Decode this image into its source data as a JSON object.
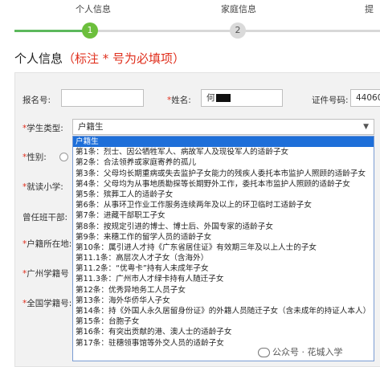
{
  "steps": [
    {
      "label": "个人信息",
      "number": "1"
    },
    {
      "label": "家庭信息",
      "number": "2"
    },
    {
      "label": "提",
      "number": ""
    }
  ],
  "section": {
    "title": "个人信息",
    "note": "（标注 * 号为必填项）"
  },
  "form": {
    "signup_label": "报名号:",
    "name_label": "*姓名:",
    "name_value": "何",
    "id_label": "证件号码:",
    "id_value": "44060",
    "student_type_label": "*学生类型:",
    "student_type_value": "户籍生",
    "gender_label": "*性别:",
    "primary_label": "*就读小学:",
    "cadre_label": "曾任班干部:",
    "hukou_label": "*户籍所在地:",
    "gz_no_label": "*广州学籍号",
    "national_no_label": "*全国学籍号:"
  },
  "dropdown": {
    "options": [
      "户籍生",
      "第1条：烈士、因公牺牲军人、病故军人及现役军人的适龄子女",
      "第2条：合法领养或家庭寄养的孤儿",
      "第3条：父母均长期重病或失去监护子女能力的残疾人委托本市监护人照顾的适龄子女",
      "第4条：父母均为从事地质勘探等长期野外工作，委托本市监护人照顾的适龄子女",
      "第5条：殡葬工人的适龄子女",
      "第6条：从事环卫作业工作服务连续两年及以上的环卫临时工适龄子女",
      "第7条：进藏干部职工子女",
      "第8条：按规定引进的博士、博士后、外国专家的适龄子女",
      "第9条：来穗工作的留学人员的适龄子女",
      "第10条：属引进人才持《广东省居住证》有效期三年及以上人士的子女",
      "第11.1条：高层次人才子女（含海外）",
      "第11.2条：“优粤卡”持有人未成年子女",
      "第11.3条：广州市人才绿卡持有人随迁子女",
      "第12条：优秀异地务工人员子女",
      "第13条：海外华侨华人子女",
      "第14条：持《外国人永久居留身份证》的外籍人员随迁子女（含未成年的持证人本人）",
      "第15条：台胞子女",
      "第16条：有突出贡献的港、澳人士的适龄子女",
      "第17条：驻穗领事馆等外交人员的适龄子女"
    ]
  },
  "watermark": "公众号 · 花城入学",
  "colors": {
    "active_step": "#6cbf3c",
    "progress": "#5cb85c",
    "required": "#e0301e",
    "highlight": "#1e6fd9"
  }
}
